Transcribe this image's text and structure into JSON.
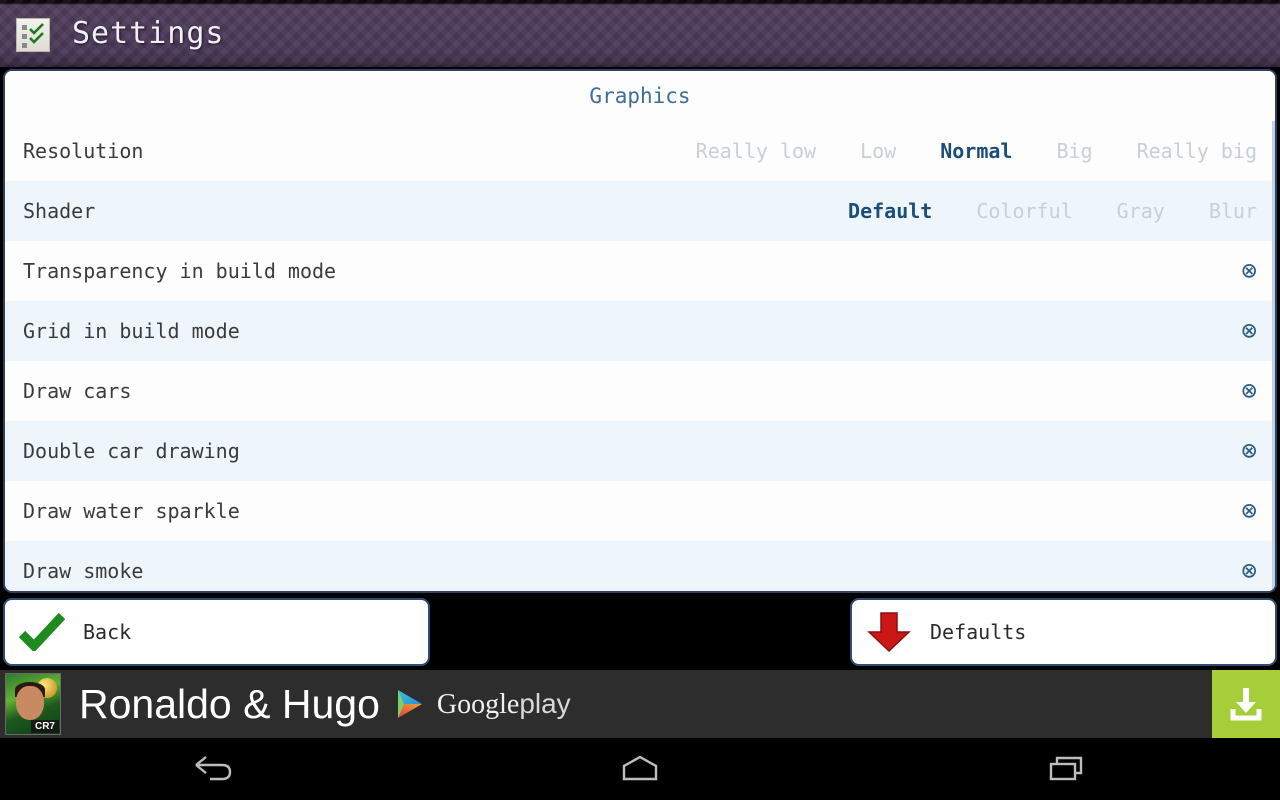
{
  "titlebar": {
    "icon": "checklist-icon",
    "title": "Settings"
  },
  "panel": {
    "title": "Graphics",
    "option_rows": [
      {
        "label": "Resolution",
        "options": [
          "Really low",
          "Low",
          "Normal",
          "Big",
          "Really big"
        ],
        "selected": "Normal"
      },
      {
        "label": "Shader",
        "options": [
          "Default",
          "Colorful",
          "Gray",
          "Blur"
        ],
        "selected": "Default"
      }
    ],
    "toggle_rows": [
      {
        "label": "Transparency in build mode",
        "state_icon": "circle-x-icon"
      },
      {
        "label": "Grid in build mode",
        "state_icon": "circle-x-icon"
      },
      {
        "label": "Draw cars",
        "state_icon": "circle-x-icon"
      },
      {
        "label": "Double car drawing",
        "state_icon": "circle-x-icon"
      },
      {
        "label": "Draw water sparkle",
        "state_icon": "circle-x-icon"
      },
      {
        "label": "Draw smoke",
        "state_icon": "circle-x-icon"
      }
    ]
  },
  "buttons": {
    "back": {
      "label": "Back",
      "icon": "green-check-icon"
    },
    "defaults": {
      "label": "Defaults",
      "icon": "red-down-arrow-icon"
    }
  },
  "ad": {
    "thumb_badge": "CR7",
    "title": "Ronaldo & Hugo",
    "store_google": "Google",
    "store_play": "play",
    "download_icon": "download-icon"
  },
  "navbar": {
    "back": "back-icon",
    "home": "home-icon",
    "recents": "recents-icon"
  },
  "colors": {
    "titlebar_purple": "#4d3c5c",
    "accent_blue": "#1d4d7a",
    "panel_border": "#2f3f66",
    "row_alt": "#eef6fc",
    "option_muted": "#c9cfd4",
    "toggle_blue": "#2e5f87",
    "ad_bg": "#2d2d2d",
    "download_green": "#a6ce39",
    "check_green": "#1f8a1f",
    "arrow_red": "#cc1717"
  }
}
